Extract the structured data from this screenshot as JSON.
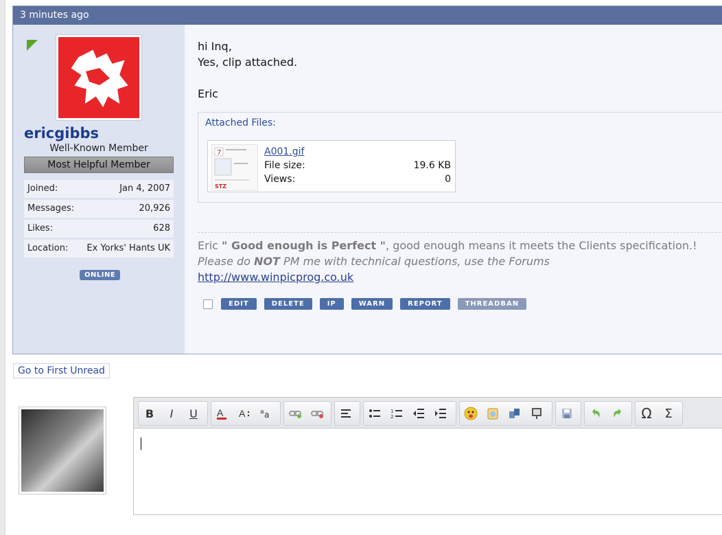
{
  "post": {
    "timestamp": "3 minutes ago",
    "user": {
      "name": "ericgibbs",
      "title": "Well-Known Member",
      "banner": "Most Helpful Member",
      "info": [
        {
          "label": "Joined:",
          "value": "Jan 4, 2007"
        },
        {
          "label": "Messages:",
          "value": "20,926"
        },
        {
          "label": "Likes:",
          "value": "628"
        },
        {
          "label": "Location:",
          "value": "Ex Yorks' Hants UK"
        }
      ],
      "online": "ONLINE"
    },
    "message": {
      "line1": "hi Inq,",
      "line2": "Yes, clip attached.",
      "line3": "Eric"
    },
    "attachments": {
      "title": "Attached Files:",
      "file": {
        "name": "A001.gif",
        "size_label": "File size:",
        "size_value": "19.6 KB",
        "views_label": "Views:",
        "views_value": "0"
      }
    },
    "signature": {
      "name": "Eric",
      "quote": "\" Good enough is Perfect \"",
      "rest": ", good enough means it meets the Clients specification.!",
      "line2_a": "Please do ",
      "line2_b": "NOT",
      "line2_c": " PM me with technical questions, use the Forums",
      "link": "http://www.winpicprog.co.uk"
    },
    "actions": [
      "EDIT",
      "DELETE",
      "IP",
      "WARN",
      "REPORT",
      "THREADBAN"
    ]
  },
  "nav": {
    "first_unread": "Go to First Unread"
  },
  "editor": {
    "toolbar": {
      "bold": "B",
      "italic": "I",
      "underline": "U",
      "special_char": "Ω",
      "formula": "Σ"
    },
    "icons": [
      "bold-icon",
      "italic-icon",
      "underline-icon",
      "text-color-icon",
      "font-size-icon",
      "font-family-icon",
      "link-icon",
      "unlink-icon",
      "align-icon",
      "bullet-list-icon",
      "numbered-list-icon",
      "outdent-icon",
      "indent-icon",
      "smilie-icon",
      "image-icon",
      "media-icon",
      "code-icon",
      "save-draft-icon",
      "undo-icon",
      "redo-icon",
      "special-char-icon",
      "formula-icon"
    ]
  }
}
